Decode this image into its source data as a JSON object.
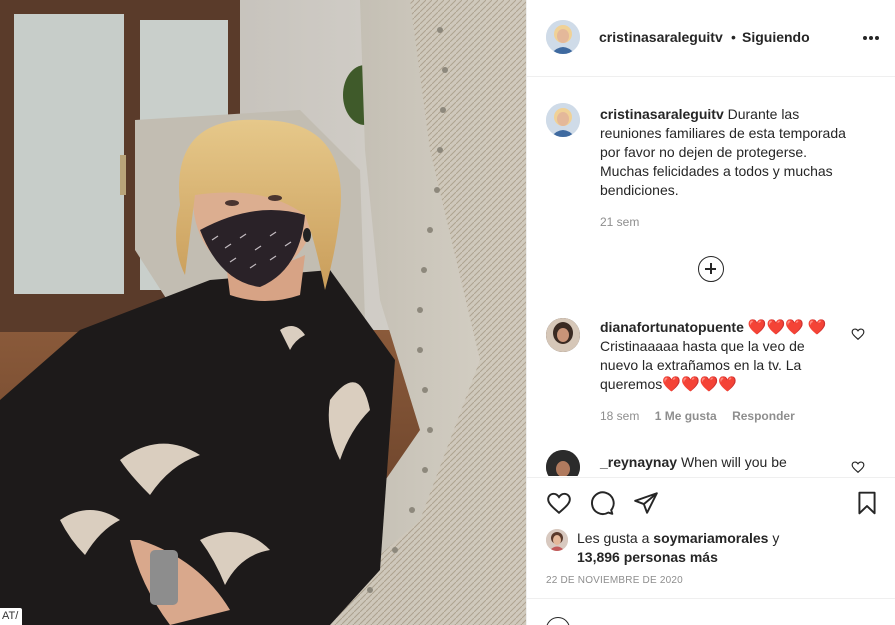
{
  "photo": {
    "credit_text": "AT/"
  },
  "header": {
    "username": "cristinasaraleguitv",
    "separator": "•",
    "follow_status": "Siguiendo",
    "more_icon": "more-horizontal-icon"
  },
  "caption": {
    "username": "cristinasaraleguitv",
    "text": "Durante las reuniones familiares de esta temporada por favor no dejen de protegerse. Muchas felicidades a todos y muchas bendiciones.",
    "time": "21 sem"
  },
  "load_more_icon": "plus-circle-icon",
  "comments": [
    {
      "username": "dianafortunatopuente",
      "text_before": "Cristinaaaaa hasta que la veo de nuevo la extrañamos en la tv. La queremos",
      "hearts_lead": "❤️❤️❤️",
      "hearts_mid": "❤️",
      "hearts_end": "❤️❤️❤️❤️",
      "time": "18 sem",
      "likes": "1 Me gusta",
      "reply": "Responder"
    },
    {
      "username": "_reynaynay",
      "text": "When will you be"
    }
  ],
  "actions": {
    "like_icon": "heart-icon",
    "comment_icon": "comment-icon",
    "share_icon": "share-icon",
    "save_icon": "bookmark-icon"
  },
  "likes_summary": {
    "prefix": "Les gusta a",
    "user": "soymariamorales",
    "joiner": "y",
    "count": "13,896 personas más"
  },
  "post_date": "22 DE NOVIEMBRE DE 2020",
  "colors": {
    "heart_red": "#e0162b",
    "text_primary": "#262626",
    "text_secondary": "#8e8e8e",
    "border": "#efefef"
  }
}
